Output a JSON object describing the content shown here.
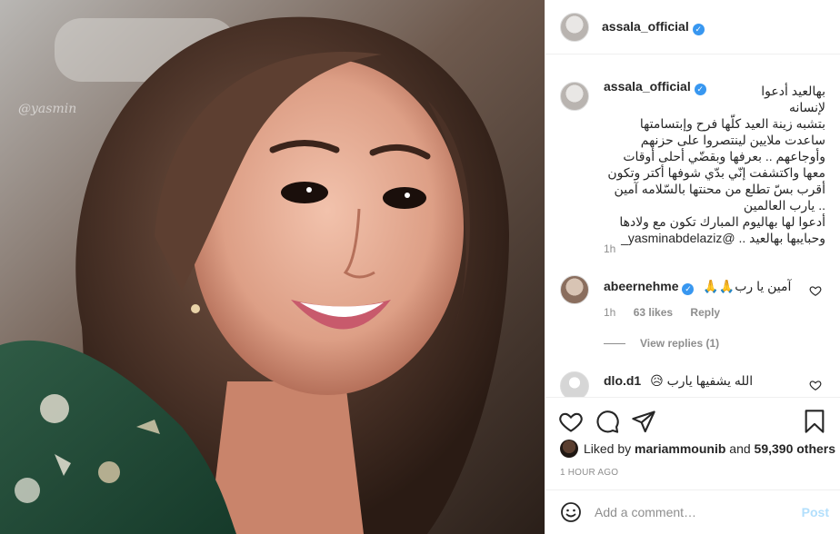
{
  "post": {
    "username": "assala_official",
    "image_watermark": "@yasmin"
  },
  "caption": {
    "username": "assala_official",
    "lines": [
      "بهالعيد أدعوا لإنسانه",
      "بتشبه زينة العيد كلّها فرح وإبتسامتها",
      "ساعدت ملايين لينتصروا على حزنهم",
      "وأوجاعهم .. بعرفها وبقضّي أحلى أوقات",
      "معها واكتشفت إنّي بدّي شوفها أكتر وتكون",
      "أقرب بسّ تطلع من محنتها بالسّلامه آمين",
      ".. يارب العالمين",
      "أدعوا لها بهاليوم المبارك تكون مع ولادها",
      "وحبايبها بهالعيد .. @yasminabdelaziz_"
    ],
    "time": "1h"
  },
  "comments": [
    {
      "username": "abeernehme",
      "verified": true,
      "text": "آمين يا رب🙏🙏",
      "time": "1h",
      "likes": "63 likes",
      "reply": "Reply",
      "view_replies": "View replies (1)"
    },
    {
      "username": "dlo.d1",
      "verified": false,
      "text": "الله يشفيها يارب 😥"
    }
  ],
  "likes": {
    "prefix": "Liked by",
    "user": "mariammounib",
    "conj": "and",
    "count": "59,390 others"
  },
  "timestamp": "1 HOUR AGO",
  "add_comment": {
    "placeholder": "Add a comment…",
    "post_label": "Post"
  },
  "colors": {
    "verified": "#3897f0",
    "muted": "#8e8e8e",
    "post_disabled": "#b2dffc"
  },
  "icons": [
    "heart-icon",
    "comment-icon",
    "share-icon",
    "bookmark-icon",
    "emoji-icon"
  ]
}
